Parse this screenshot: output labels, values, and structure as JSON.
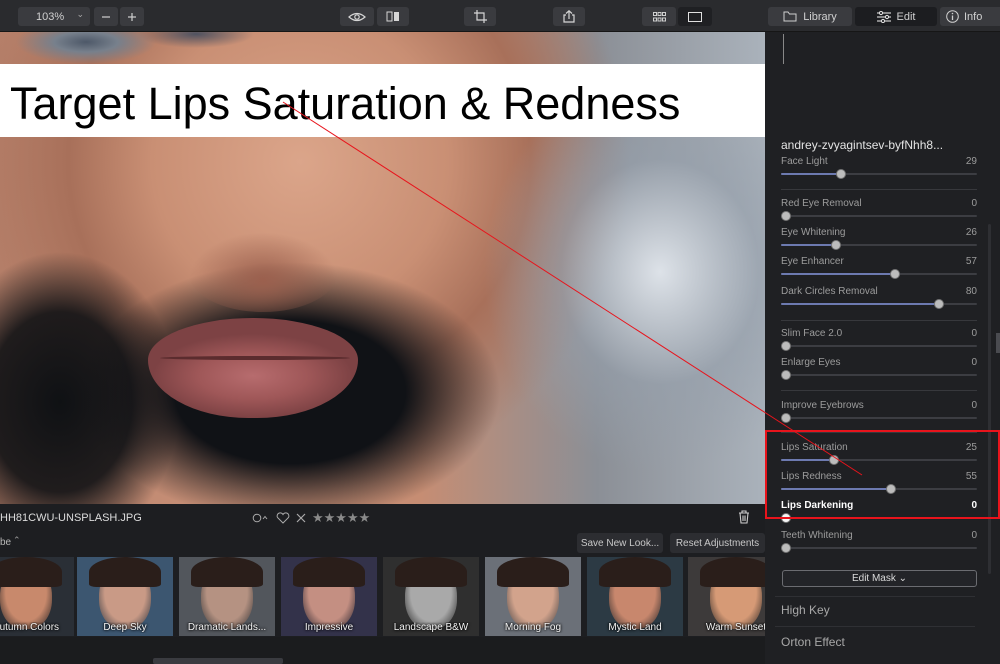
{
  "toolbar": {
    "zoom": "103%",
    "zoom_chevron": "⌄",
    "library_label": "Library",
    "edit_label": "Edit",
    "info_label": "Info"
  },
  "banner": {
    "text": "Target Lips Saturation & Redness"
  },
  "status": {
    "filename": "HH81CWU-UNSPLASH.JPG",
    "stars": "★★★★★"
  },
  "looks": {
    "section_label": "be",
    "save_label": "Save New Look...",
    "reset_label": "Reset Adjustments",
    "items": [
      {
        "label": "Autumn Colors",
        "tone": "#c8896c",
        "bg": "#2a2f36"
      },
      {
        "label": "Deep Sky",
        "tone": "#c99a86",
        "bg": "#3c5670"
      },
      {
        "label": "Dramatic Lands...",
        "tone": "#b59282",
        "bg": "#52565c"
      },
      {
        "label": "Impressive",
        "tone": "#c48f82",
        "bg": "#33324a"
      },
      {
        "label": "Landscape B&W",
        "tone": "#a9a9a9",
        "bg": "#2f2f2f"
      },
      {
        "label": "Morning Fog",
        "tone": "#d2a38c",
        "bg": "#6b7078"
      },
      {
        "label": "Mystic Land",
        "tone": "#c8876d",
        "bg": "#2c3a44"
      },
      {
        "label": "Warm Sunset",
        "tone": "#d69a76",
        "bg": "#3d3a3a"
      }
    ]
  },
  "panel": {
    "title": "andrey-zvyagintsev-byfNhh8...",
    "sliders": [
      {
        "label": "Face Light",
        "value": "29",
        "level": 29
      },
      {
        "label": "Red Eye Removal",
        "value": "0",
        "level": 0
      },
      {
        "label": "Eye Whitening",
        "value": "26",
        "level": 26
      },
      {
        "label": "Eye Enhancer",
        "value": "57",
        "level": 57
      },
      {
        "label": "Dark Circles Removal",
        "value": "80",
        "level": 80
      },
      {
        "label": "Slim Face 2.0",
        "value": "0",
        "level": 0
      },
      {
        "label": "Enlarge Eyes",
        "value": "0",
        "level": 0
      },
      {
        "label": "Improve Eyebrows",
        "value": "0",
        "level": 0
      },
      {
        "label": "Lips Saturation",
        "value": "25",
        "level": 25
      },
      {
        "label": "Lips Redness",
        "value": "55",
        "level": 55
      },
      {
        "label": "Lips Darkening",
        "value": "0",
        "level": 0
      },
      {
        "label": "Teeth Whitening",
        "value": "0",
        "level": 0
      }
    ],
    "edit_mask_label": "Edit Mask ⌄",
    "sections": [
      "High Key",
      "Orton Effect"
    ]
  },
  "colors": {
    "accent_fill": "#6d7ab0",
    "annotation_red": "#e8141c"
  }
}
